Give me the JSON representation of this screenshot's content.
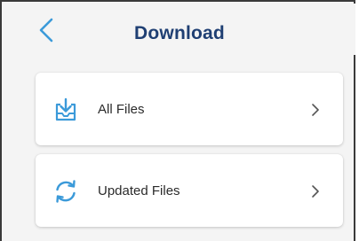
{
  "header": {
    "title": "Download"
  },
  "items": [
    {
      "label": "All Files",
      "icon": "download-tray-icon"
    },
    {
      "label": "Updated Files",
      "icon": "sync-icon"
    }
  ],
  "colors": {
    "accent": "#3b9ad9",
    "title": "#1f3f73",
    "background": "#f4f4f4",
    "card": "#ffffff"
  }
}
